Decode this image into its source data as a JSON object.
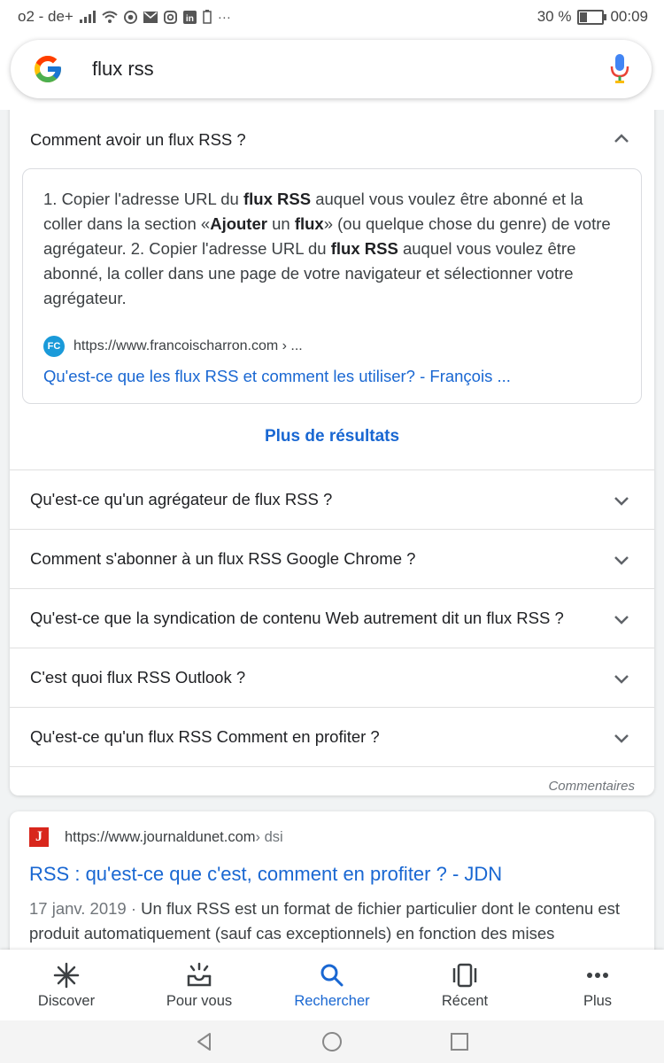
{
  "status_bar": {
    "carrier": "o2 - de+",
    "battery_percent": "30 %",
    "battery_level": 0.3,
    "time": "00:09",
    "more_notifications": "···"
  },
  "search": {
    "query": "flux rss"
  },
  "people_also_ask": {
    "open_question": "Comment avoir un flux RSS ?",
    "answer_parts": {
      "p1": "1. Copier l'adresse URL du ",
      "b1": "flux RSS",
      "p2": " auquel vous voulez être abonné et la coller dans la section «",
      "b2": "Ajouter",
      "p3": " un ",
      "b3": "flux",
      "p4": "» (ou quelque chose du genre) de votre agrégateur. 2. Copier l'adresse URL du ",
      "b4": "flux RSS",
      "p5": " auquel vous voulez être abonné, la coller dans une page de votre navigateur et sélectionner votre agrégateur."
    },
    "source_logo_text": "FC",
    "source_url": "https://www.francoischarron.com › ...",
    "source_title": "Qu'est-ce que les flux RSS et comment les utiliser? - François ...",
    "more_results": "Plus de résultats",
    "questions": [
      "Qu'est-ce qu'un agrégateur de flux RSS ?",
      "Comment s'abonner à un flux RSS Google Chrome ?",
      "Qu'est-ce que la syndication de contenu Web autrement dit un flux RSS ?",
      "C'est quoi flux RSS Outlook ?",
      "Qu'est-ce qu'un flux RSS Comment en profiter ?"
    ],
    "feedback": "Commentaires"
  },
  "result": {
    "logo_text": "J",
    "url": "https://www.journaldunet.com",
    "breadcrumb": " › dsi",
    "title": "RSS : qu'est-ce que c'est, comment en profiter ? - JDN",
    "date": "17 janv. 2019 · ",
    "snippet": "Un flux RSS est un format de fichier particulier dont le contenu est produit automatiquement (sauf cas exceptionnels) en fonction des mises"
  },
  "bottom_nav": [
    {
      "label": "Discover",
      "icon": "asterisk-icon"
    },
    {
      "label": "Pour vous",
      "icon": "inbox-icon"
    },
    {
      "label": "Rechercher",
      "icon": "search-icon",
      "active": true
    },
    {
      "label": "Récent",
      "icon": "recent-cards-icon"
    },
    {
      "label": "Plus",
      "icon": "more-dots-icon"
    }
  ],
  "colors": {
    "link_blue": "#1967d2",
    "text": "#202124",
    "jdn_red": "#d8261c",
    "fc_blue": "#1a9ad9"
  }
}
